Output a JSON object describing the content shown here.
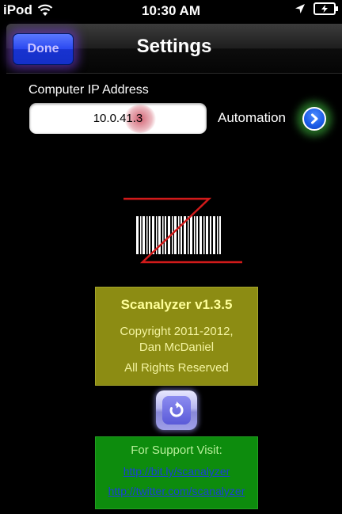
{
  "status_bar": {
    "carrier": "iPod",
    "time": "10:30 AM",
    "wifi_icon": "wifi-icon",
    "location_icon": "location-arrow-icon",
    "battery_icon": "battery-charging-icon"
  },
  "nav": {
    "done_label": "Done",
    "title": "Settings"
  },
  "settings": {
    "ip_label": "Computer IP Address",
    "ip_value": "10.0.41.3",
    "automation_label": "Automation",
    "automation_icon": "chevron-right-circle-icon"
  },
  "about": {
    "app_name": "Scanalyzer v1.3.5",
    "copyright_line1": "Copyright 2011-2012,",
    "copyright_line2": "Dan McDaniel",
    "rights": "All Rights Reserved"
  },
  "refresh_icon": "refresh-icon",
  "support": {
    "title": "For Support Visit:",
    "link1": "http://bit.ly/scanalyzer",
    "link2": "http://twitter.com/scanalyzer"
  },
  "colors": {
    "info_box": "#8c8c13",
    "support_box": "#0d8c0d",
    "done_button": "#2a48f0",
    "link": "#1a3fd8"
  }
}
